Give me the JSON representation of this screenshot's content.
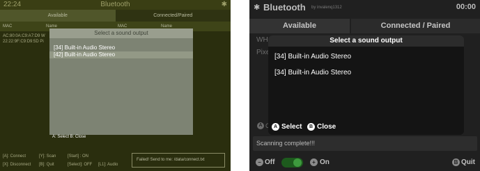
{
  "left": {
    "time": "22:24",
    "title": "Bluetooth",
    "bt_icon": "bluetooth-icon",
    "tabs": [
      "Available",
      "Connected/Paired"
    ],
    "columns": [
      "MAC",
      "Name",
      "MAC",
      "Name"
    ],
    "rows": [
      {
        "mac": "AC:80:0A:C9:A7:D9",
        "name": "W"
      },
      {
        "mac": "22:22:9F:C9:D9:5D",
        "name": "Pi"
      }
    ],
    "dialog": {
      "title": "Select a sound output",
      "items": [
        "[34] Built-in Audio Stereo",
        "[42] Built-in Audio Stereo"
      ],
      "hint": "A: Select   B: Close"
    },
    "controls": {
      "connect": "[A]: Connect",
      "scan": "[Y]: Scan",
      "start": "[Start] : ON",
      "disconnect": "[X]: Disconnect",
      "quit": "[B]: Quit",
      "select": "[Select]: OFF",
      "l1": "[L1]: Audio"
    },
    "status": "Failed! Send to me: /data/connect.txt"
  },
  "right": {
    "bt_icon": "bluetooth-icon",
    "title": "Bluetooth",
    "byline": "by invalenq1312",
    "clock": "00:00",
    "tabs": [
      "Available",
      "Connected / Paired"
    ],
    "bg_texts": [
      "WH",
      "Pixe"
    ],
    "bg_circle": "A",
    "bg_trailing": "C",
    "dialog": {
      "title": "Select a sound output",
      "items": [
        "[34] Built-in Audio Stereo",
        "[34] Built-in Audio Stereo"
      ],
      "select_button": "A",
      "select_label": "Select",
      "close_button": "B",
      "close_label": "Close"
    },
    "status": "Scanning complete!!!",
    "bottom": {
      "off_icon": "minus-icon",
      "off_label": "Off",
      "on_icon": "plus-icon",
      "on_label": "On",
      "quit_button": "B",
      "quit_label": "Quit",
      "toggle_state": "on"
    }
  },
  "colors": {
    "left_bg": "#2a2e0e",
    "left_dialog": "#7d8373",
    "right_bg": "#202020",
    "right_toggle": "#3e9a3e"
  }
}
